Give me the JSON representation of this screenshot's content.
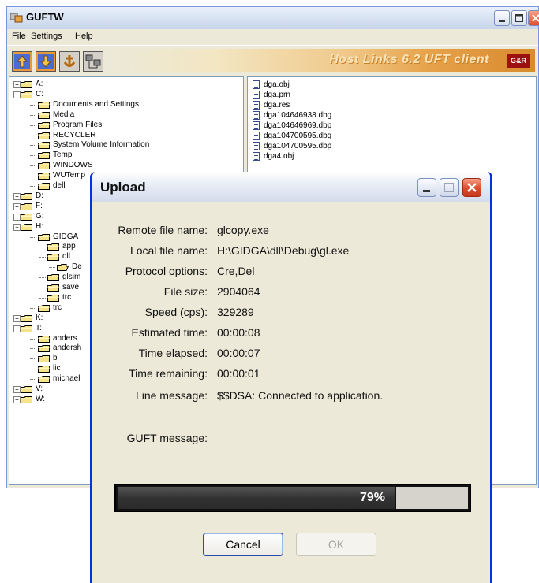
{
  "main_window": {
    "title": "GUFTW",
    "menu": [
      "File",
      "Settings",
      "Help"
    ],
    "banner_text": "Host Links 6.2 UFT client",
    "banner_logo": "G&R"
  },
  "tree": [
    {
      "label": "A:",
      "expander": "+",
      "depth": 0
    },
    {
      "label": "C:",
      "expander": "−",
      "depth": 0
    },
    {
      "label": "Documents and Settings",
      "depth": 1
    },
    {
      "label": "Media",
      "depth": 1
    },
    {
      "label": "Program Files",
      "depth": 1
    },
    {
      "label": "RECYCLER",
      "depth": 1
    },
    {
      "label": "System Volume Information",
      "depth": 1
    },
    {
      "label": "Temp",
      "depth": 1
    },
    {
      "label": "WINDOWS",
      "depth": 1
    },
    {
      "label": "WUTemp",
      "depth": 1
    },
    {
      "label": "dell",
      "depth": 1
    },
    {
      "label": "D:",
      "expander": "+",
      "depth": 0
    },
    {
      "label": "F:",
      "expander": "+",
      "depth": 0
    },
    {
      "label": "G:",
      "expander": "+",
      "depth": 0
    },
    {
      "label": "H:",
      "expander": "−",
      "depth": 0
    },
    {
      "label": "GIDGA",
      "depth": 1
    },
    {
      "label": "app",
      "depth": 2
    },
    {
      "label": "dll",
      "depth": 2
    },
    {
      "label": "De",
      "depth": 3,
      "open": true
    },
    {
      "label": "glsim",
      "depth": 2
    },
    {
      "label": "save",
      "depth": 2
    },
    {
      "label": "trc",
      "depth": 2
    },
    {
      "label": "trc",
      "depth": 1
    },
    {
      "label": "K:",
      "expander": "+",
      "depth": 0
    },
    {
      "label": "T:",
      "expander": "−",
      "depth": 0
    },
    {
      "label": "anders",
      "depth": 1
    },
    {
      "label": "andersh",
      "depth": 1
    },
    {
      "label": "b",
      "depth": 1
    },
    {
      "label": "lic",
      "depth": 1
    },
    {
      "label": "michael",
      "depth": 1
    },
    {
      "label": "V:",
      "expander": "+",
      "depth": 0
    },
    {
      "label": "W:",
      "expander": "+",
      "depth": 0
    }
  ],
  "files": [
    "dga.obj",
    "dga.prn",
    "dga.res",
    "dga104646938.dbg",
    "dga104646969.dbp",
    "dga104700595.dbg",
    "dga104700595.dbp",
    "dga4.obj"
  ],
  "upload_dialog": {
    "title": "Upload",
    "fields": [
      {
        "label": "Remote file name:",
        "value": "glcopy.exe"
      },
      {
        "label": "Local file name:",
        "value": "H:\\GIDGA\\dll\\Debug\\gl.exe"
      },
      {
        "label": "Protocol options:",
        "value": "Cre,Del"
      },
      {
        "label": "File size:",
        "value": "2904064"
      },
      {
        "label": "Speed (cps):",
        "value": "329289"
      },
      {
        "label": "Estimated time:",
        "value": "00:00:08"
      },
      {
        "label": "Time elapsed:",
        "value": "00:00:07"
      },
      {
        "label": "Time remaining:",
        "value": "00:00:01"
      },
      {
        "label": "Line message:",
        "value": "$$DSA: Connected to application."
      }
    ],
    "guft_label": "GUFT message:",
    "guft_value": "",
    "progress_percent": 79,
    "progress_text": "79%",
    "cancel_label": "Cancel",
    "ok_label": "OK"
  }
}
